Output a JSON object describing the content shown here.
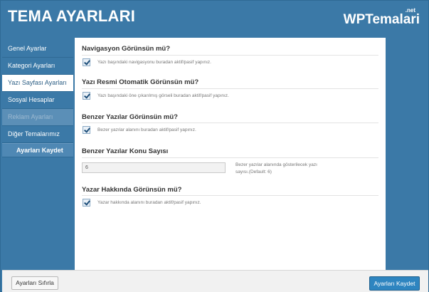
{
  "header": {
    "title": "TEMA AYARLARI",
    "brand": "WPTemalari",
    "brand_sup": ".net"
  },
  "sidebar": {
    "items": [
      {
        "label": "Genel Ayarlar"
      },
      {
        "label": "Kategori Ayarları"
      },
      {
        "label": "Yazı Sayfası Ayarları"
      },
      {
        "label": "Sosyal Hesaplar"
      },
      {
        "label": "Reklam Ayarları"
      },
      {
        "label": "Diğer Temalarımız"
      }
    ],
    "active_index": 2,
    "save_label": "Ayarları Kaydet"
  },
  "sections": [
    {
      "title": "Navigasyon Görünsün mü?",
      "checked": true,
      "hint": "Yazı başındaki navigasyonu buradan aktif/pasif yapınız."
    },
    {
      "title": "Yazı Resmi Otomatik Görünsün mü?",
      "checked": true,
      "hint": "Yazı başındaki öne çıkarılmış görseli buradan aktif/pasif yapınız."
    },
    {
      "title": "Benzer Yazılar Görünsün mü?",
      "checked": true,
      "hint": "Bezer yazılar alanını buradan aktif/pasif yapınız."
    },
    {
      "title": "Benzer Yazılar Konu Sayısı",
      "value": "6",
      "hint": "Bezer yazılar alanında gösterilecek yazı sayısı.(Default: 6)"
    },
    {
      "title": "Yazar Hakkında Görünsün mü?",
      "checked": true,
      "hint": "Yazar hakkında alanını buradan aktif/pasif yapınız."
    }
  ],
  "footer": {
    "reset_label": "Ayarları Sıfırla",
    "save_label": "Ayarları Kaydet"
  }
}
